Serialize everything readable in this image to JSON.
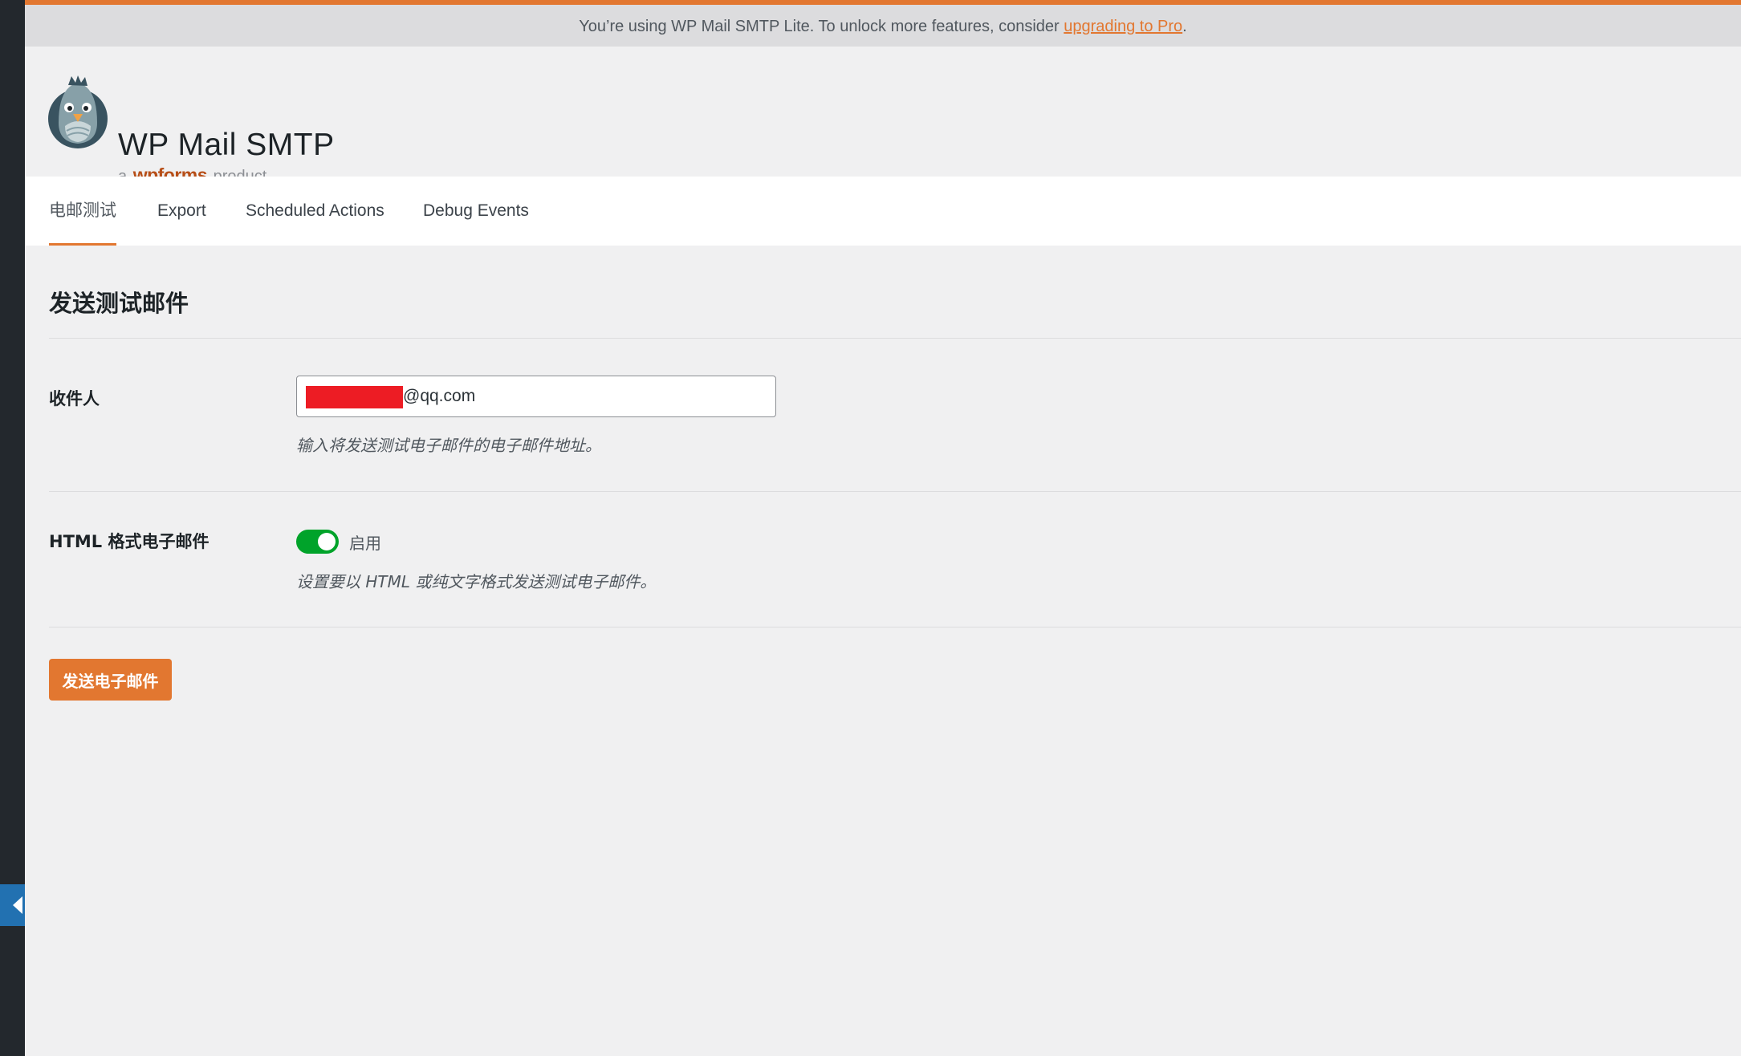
{
  "notice": {
    "text": "You’re using WP Mail SMTP Lite. To unlock more features, consider ",
    "link": "upgrading to Pro",
    "suffix": "."
  },
  "brand": {
    "title": "WP Mail SMTP",
    "sub_prefix": "a",
    "sub_brand": "wpforms",
    "sub_suffix": "product"
  },
  "tabs": [
    {
      "label": "电邮测试",
      "active": true
    },
    {
      "label": "Export",
      "active": false
    },
    {
      "label": "Scheduled Actions",
      "active": false
    },
    {
      "label": "Debug Events",
      "active": false
    }
  ],
  "section": {
    "title": "发送测试邮件"
  },
  "recipient": {
    "label": "收件人",
    "value": "@qq.com",
    "description": "输入将发送测试电子邮件的电子邮件地址。"
  },
  "html_format": {
    "label": "HTML 格式电子邮件",
    "toggle_label": "启用",
    "enabled": true,
    "description": "设置要以 HTML 或纯文字格式发送测试电子邮件。"
  },
  "actions": {
    "send_label": "发送电子邮件"
  },
  "colors": {
    "accent": "#e27730",
    "toggle_on": "#00a32a",
    "redaction": "#ed1c24",
    "sidebar": "#23282d",
    "sidebar_tab": "#2271b1"
  },
  "icons": {
    "logo": "pigeon-logo-icon",
    "sidebar_toggle": "collapse-arrow-icon"
  }
}
